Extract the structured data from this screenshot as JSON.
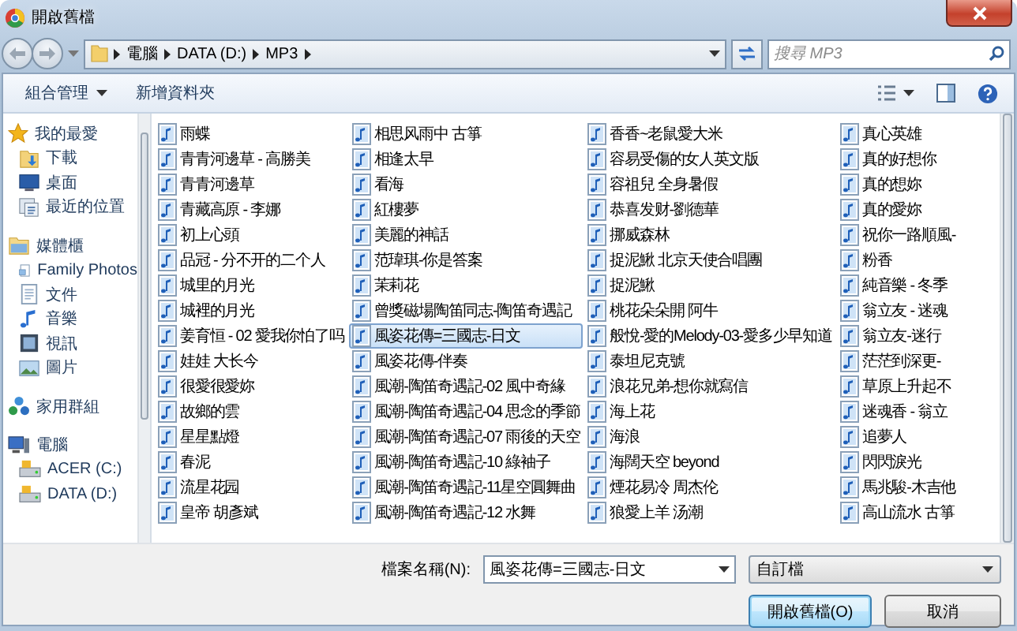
{
  "window": {
    "title": "開啟舊檔"
  },
  "address": {
    "path": [
      "電腦",
      "DATA (D:)",
      "MP3"
    ]
  },
  "search": {
    "placeholder": "搜尋 MP3"
  },
  "toolbar": {
    "buttons": [
      {
        "label": "組合管理",
        "kind": "menu"
      },
      {
        "label": "新增資料夾",
        "kind": "plain"
      }
    ]
  },
  "sidebar": {
    "groups": [
      {
        "label": "我的最愛",
        "kind": "favorites",
        "children": [
          {
            "label": "下載",
            "kind": "download"
          },
          {
            "label": "桌面",
            "kind": "desktop"
          },
          {
            "label": "最近的位置",
            "kind": "recent"
          }
        ]
      },
      {
        "label": "媒體櫃",
        "kind": "libraries",
        "children": [
          {
            "label": "Family Photos",
            "kind": "photos"
          },
          {
            "label": "文件",
            "kind": "document"
          },
          {
            "label": "音樂",
            "kind": "music"
          },
          {
            "label": "視訊",
            "kind": "video"
          },
          {
            "label": "圖片",
            "kind": "picture"
          }
        ]
      },
      {
        "label": "家用群組",
        "kind": "homegroup"
      },
      {
        "label": "電腦",
        "kind": "computer",
        "children": [
          {
            "label": "ACER (C:)",
            "kind": "drive"
          },
          {
            "label": "DATA (D:)",
            "kind": "drive"
          }
        ]
      }
    ]
  },
  "files": [
    {
      "name": "雨蝶",
      "selected": false
    },
    {
      "name": "青青河邊草 - 高勝美",
      "selected": false
    },
    {
      "name": "青青河邊草",
      "selected": false
    },
    {
      "name": "青藏高原 - 李娜",
      "selected": false
    },
    {
      "name": "初上心頭",
      "selected": false
    },
    {
      "name": "品冠 - 分不开的二个人",
      "selected": false
    },
    {
      "name": "城里的月光",
      "selected": false
    },
    {
      "name": "城裡的月光",
      "selected": false
    },
    {
      "name": "姜育恒 - 02 愛我你怕了吗",
      "selected": false
    },
    {
      "name": "娃娃 大长今",
      "selected": false
    },
    {
      "name": "很愛很愛妳",
      "selected": false
    },
    {
      "name": "故鄉的雲",
      "selected": false
    },
    {
      "name": "星星點燈",
      "selected": false
    },
    {
      "name": "春泥",
      "selected": false
    },
    {
      "name": "流星花园",
      "selected": false
    },
    {
      "name": "皇帝 胡彥斌",
      "selected": false
    },
    {
      "name": "相思风雨中 古箏",
      "selected": false
    },
    {
      "name": "相逢太早",
      "selected": false
    },
    {
      "name": "看海",
      "selected": false
    },
    {
      "name": "紅樓夢",
      "selected": false
    },
    {
      "name": "美麗的神話",
      "selected": false
    },
    {
      "name": "范瑋琪-你是答案",
      "selected": false
    },
    {
      "name": "茉莉花",
      "selected": false
    },
    {
      "name": "曾獎磁場陶笛同志-陶笛奇遇記",
      "selected": false
    },
    {
      "name": "風姿花傳=三國志-日文",
      "selected": true
    },
    {
      "name": "風姿花傳-伴奏",
      "selected": false
    },
    {
      "name": "風潮-陶笛奇遇記-02 風中奇緣",
      "selected": false
    },
    {
      "name": "風潮-陶笛奇遇記-04 思念的季節",
      "selected": false
    },
    {
      "name": "風潮-陶笛奇遇記-07 雨後的天空",
      "selected": false
    },
    {
      "name": "風潮-陶笛奇遇記-10 綠袖子",
      "selected": false
    },
    {
      "name": "風潮-陶笛奇遇記-11星空圓舞曲",
      "selected": false
    },
    {
      "name": "風潮-陶笛奇遇記-12 水舞",
      "selected": false
    },
    {
      "name": "香香~老鼠愛大米",
      "selected": false
    },
    {
      "name": "容易受傷的女人英文版",
      "selected": false
    },
    {
      "name": "容祖兒 全身暑假",
      "selected": false
    },
    {
      "name": "恭喜发财-劉德華",
      "selected": false
    },
    {
      "name": "挪威森林",
      "selected": false
    },
    {
      "name": "捉泥鰍 北京天使合唱團",
      "selected": false
    },
    {
      "name": "捉泥鰍",
      "selected": false
    },
    {
      "name": "桃花朵朵開 阿牛",
      "selected": false
    },
    {
      "name": "般悅-愛的Melody-03-愛多少早知道",
      "selected": false
    },
    {
      "name": "泰坦尼克號",
      "selected": false
    },
    {
      "name": "浪花兄弟-想你就寫信",
      "selected": false
    },
    {
      "name": "海上花",
      "selected": false
    },
    {
      "name": "海浪",
      "selected": false
    },
    {
      "name": "海闊天空 beyond",
      "selected": false
    },
    {
      "name": "煙花易冷 周杰伦",
      "selected": false
    },
    {
      "name": "狼愛上羊 汤潮",
      "selected": false
    },
    {
      "name": "真心英雄",
      "selected": false
    },
    {
      "name": "真的好想你",
      "selected": false
    },
    {
      "name": "真的想妳",
      "selected": false
    },
    {
      "name": "真的愛妳",
      "selected": false
    },
    {
      "name": "祝你一路順風-",
      "selected": false
    },
    {
      "name": "粉香",
      "selected": false
    },
    {
      "name": "純音樂 - 冬季",
      "selected": false
    },
    {
      "name": "翁立友 - 迷魂",
      "selected": false
    },
    {
      "name": "翁立友-迷行",
      "selected": false
    },
    {
      "name": "茫茫到深更-",
      "selected": false
    },
    {
      "name": "草原上升起不",
      "selected": false
    },
    {
      "name": "迷魂香 - 翁立",
      "selected": false
    },
    {
      "name": "追夢人",
      "selected": false
    },
    {
      "name": "閃閃淚光",
      "selected": false
    },
    {
      "name": "馬兆駿-木吉他",
      "selected": false
    },
    {
      "name": "高山流水 古箏",
      "selected": false
    }
  ],
  "footer": {
    "filename_label": "檔案名稱(N):",
    "filename": "風姿花傳=三國志-日文",
    "filetype": "自訂檔",
    "buttons": [
      {
        "label": "開啟舊檔(O)",
        "default": true
      },
      {
        "label": "取消",
        "default": false
      }
    ]
  }
}
